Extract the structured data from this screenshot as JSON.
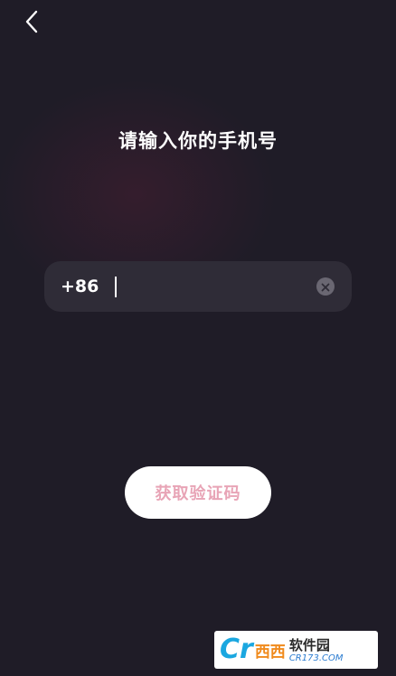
{
  "header": {
    "back_icon": "chevron-left-icon"
  },
  "title": "请输入你的手机号",
  "phone": {
    "country_code": "+86",
    "value": "",
    "placeholder": "",
    "clear_icon": "clear-icon"
  },
  "actions": {
    "get_code_label": "获取验证码"
  },
  "watermark": {
    "logo_letter": "Cr",
    "logo_text": "西西",
    "name": "软件园",
    "url": "CR173.COM"
  },
  "colors": {
    "background": "#1f1c27",
    "input_background": "#2f2c37",
    "button_text": "#e8a4b6",
    "button_background": "#ffffff"
  }
}
